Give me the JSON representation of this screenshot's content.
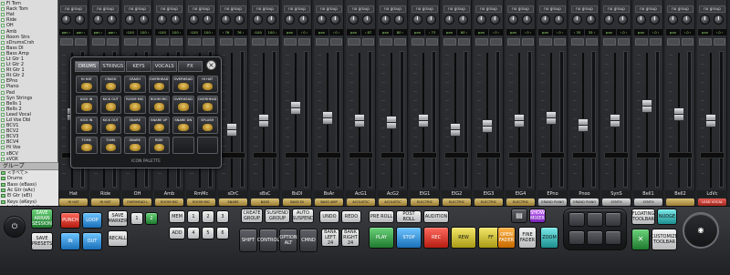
{
  "tracks": [
    "Fl Tom",
    "Rack Tom",
    "Hat",
    "Ride",
    "OH",
    "Amb",
    "Room Strs",
    "sDrumsCrsh",
    "Bass DI",
    "Bass Amp",
    "Lt Gtr 1",
    "Lt Gtr 2",
    "Rt Gtr 1",
    "Rt Gtr 2",
    "EPno",
    "Piano",
    "Pad",
    "Syn Strings",
    "Bells 1",
    "Bells 2",
    "Lead Vocal",
    "Ld Vox Dbl",
    "BCV1",
    "BCV2",
    "BCV3",
    "BCV4",
    "Hi Vox",
    "sBCV",
    "sVOX"
  ],
  "group_header": "グループ",
  "groups": [
    "<すべて>",
    "Drums",
    "Bass (eBass)",
    "Ac Gtr (eAc)",
    "El Gtr (eEl)",
    "Keys (eKeys)",
    "Ld Vocal (eLd)",
    "BCV (eBCV)",
    "FX (eFX)"
  ],
  "mixer": {
    "group_label": "no group",
    "strips": [
      {
        "name": "Hat",
        "plug": "HI HAT",
        "pan_l": "pan ‹ 48",
        "pan_r": "pan ‹ 50",
        "fader": 0.55,
        "style": "normal"
      },
      {
        "name": "Ride",
        "plug": "HI HAT",
        "pan_l": "pan ‹ 58",
        "pan_r": "pan ‹ 60",
        "fader": 0.6,
        "style": "normal"
      },
      {
        "name": "OH",
        "plug": "OVERHEAD L",
        "pan_l": "‹100",
        "pan_r": "100 ›",
        "fader": 0.38,
        "style": "normal"
      },
      {
        "name": "Amb",
        "plug": "ROOM MIC",
        "pan_l": "‹100",
        "pan_r": "100 ›",
        "fader": 0.45,
        "style": "normal"
      },
      {
        "name": "RmMc",
        "plug": "ROOM MIC",
        "pan_l": "‹100",
        "pan_r": "100 ›",
        "fader": 0.52,
        "style": "normal"
      },
      {
        "name": "sDrC",
        "plug": "SNARE",
        "pan_l": "‹ 76",
        "pan_r": "76 ›",
        "fader": 0.42,
        "style": "normal"
      },
      {
        "name": "sBsC",
        "plug": "BASS",
        "pan_l": "‹100",
        "pan_r": "100 ›",
        "fader": 0.5,
        "style": "normal"
      },
      {
        "name": "BsDI",
        "plug": "BASS DI",
        "pan_l": "pan",
        "pan_r": "‹ 0 ›",
        "fader": 0.6,
        "style": "normal"
      },
      {
        "name": "BsAr",
        "plug": "BASS AMP",
        "pan_l": "pan",
        "pan_r": "‹ 0 ›",
        "fader": 0.52,
        "style": "normal"
      },
      {
        "name": "AcG1",
        "plug": "ACOUSTIC",
        "pan_l": "pan",
        "pan_r": "‹ 87",
        "fader": 0.5,
        "style": "normal"
      },
      {
        "name": "AcG2",
        "plug": "ACOUSTIC",
        "pan_l": "pan",
        "pan_r": "80 ›",
        "fader": 0.48,
        "style": "normal"
      },
      {
        "name": "ElG1",
        "plug": "ELECTRIC",
        "pan_l": "pan",
        "pan_r": "‹ 73",
        "fader": 0.5,
        "style": "normal"
      },
      {
        "name": "ElG2",
        "plug": "ELECTRIC",
        "pan_l": "pan",
        "pan_r": "60 ›",
        "fader": 0.42,
        "style": "normal"
      },
      {
        "name": "ElG3",
        "plug": "ELECTRIC",
        "pan_l": "pan",
        "pan_r": "‹ 0 ›",
        "fader": 0.45,
        "style": "normal"
      },
      {
        "name": "ElG4",
        "plug": "ELECTRIC",
        "pan_l": "pan",
        "pan_r": "‹ 0 ›",
        "fader": 0.5,
        "style": "normal"
      },
      {
        "name": "EPno",
        "plug": "GRAND PIANO",
        "pan_l": "pan",
        "pan_r": "‹ 0 ›",
        "fader": 0.52,
        "style": "synth"
      },
      {
        "name": "Pnoo",
        "plug": "GRAND PIANO",
        "pan_l": "‹ 35",
        "pan_r": "35 ›",
        "fader": 0.46,
        "style": "synth"
      },
      {
        "name": "SynS",
        "plug": "SYNTH",
        "pan_l": "pan",
        "pan_r": "‹ 0 ›",
        "fader": 0.5,
        "style": "synth"
      },
      {
        "name": "Bell1",
        "plug": "SYNTH",
        "pan_l": "pan",
        "pan_r": "‹ 0 ›",
        "fader": 0.62,
        "style": "synth"
      },
      {
        "name": "Bell2",
        "plug": "",
        "pan_l": "pan",
        "pan_r": "‹ 0 ›",
        "fader": 0.55,
        "style": "normal"
      },
      {
        "name": "LdVc",
        "plug": "LEAD VOCAL",
        "pan_l": "pan",
        "pan_r": "‹ 0 ›",
        "fader": 0.5,
        "style": "lead"
      }
    ]
  },
  "palette": {
    "tabs": [
      "DRUMS",
      "STRINGS",
      "KEYS",
      "VOCALS",
      "FX"
    ],
    "active_tab": 0,
    "close": "×",
    "footer": "ICON PALETTE",
    "cells": [
      "HI HAT",
      "CRASH",
      "CRASH",
      "OVERHEAD",
      "OVERHEAD",
      "HI HAT",
      "KICK IN",
      "KICK OUT",
      "ROOM MIC",
      "ROOM MIC",
      "OVERHEAD",
      "OVERHEAD",
      "KICK IN",
      "KICK OUT",
      "SNARE",
      "SNARE UP",
      "SNARE DN",
      "SPLASH",
      "TOMS",
      "TOMS",
      "SNARE",
      "RIDE",
      "",
      ""
    ]
  },
  "controls": {
    "save_arrangement": "SAVE ARRAN SESSION",
    "save_preset": "SAVE PRESETS",
    "punch": "PUNCH",
    "loop": "LOOP",
    "in": "IN",
    "out": "OUT",
    "save_marker": "SAVE MARKER",
    "recall": "RECALL",
    "digits": [
      "1",
      "2",
      "3",
      "4",
      "5",
      "6",
      "7",
      "8"
    ],
    "mem_label": "MEM",
    "add_label": "ADD",
    "create_group": "CREATE GROUP",
    "suspend_group": "SUSPEND GROUP",
    "auto_suspend": "AUTO SUSPEND",
    "undo": "UNDO",
    "redo": "REDO",
    "shift": "SHIFT",
    "control": "CONTROL",
    "option": "OPTION ALT",
    "cmd": "CMND",
    "bank_left": "BANK LEFT 24",
    "bank_right": "BANK RIGHT 24",
    "pre_roll": "PRE ROLL",
    "post_roll": "POST ROLL",
    "audition": "AUDITION",
    "play": "PLAY",
    "stop": "STOP",
    "rec": "REC",
    "rew": "REW",
    "ff": "FF",
    "show_mixer": "SHOW MIXER",
    "open_fader": "OPEN FADER",
    "fine_fader": "FINE FADER",
    "floating_toolbar": "FLOATING TOOLBAR",
    "customize_toolbar": "CUSTOMIZE TOOLBAR",
    "zoom": "ZOOM",
    "nudge": "NUDGE"
  }
}
